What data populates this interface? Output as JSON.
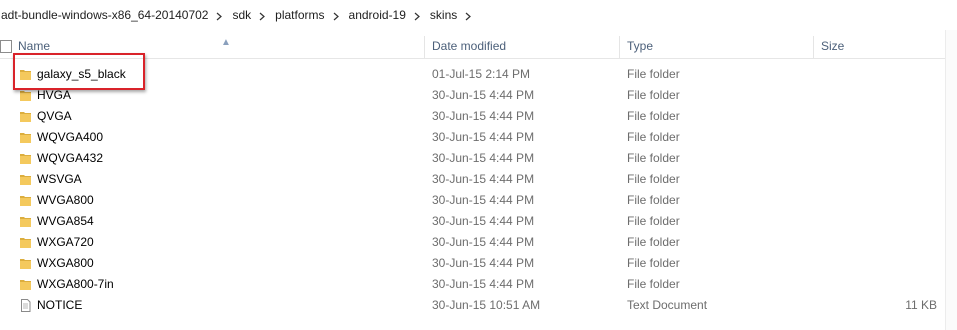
{
  "breadcrumb": [
    {
      "label": "adt-bundle-windows-x86_64-20140702"
    },
    {
      "label": "sdk"
    },
    {
      "label": "platforms"
    },
    {
      "label": "android-19"
    },
    {
      "label": "skins"
    }
  ],
  "columns": {
    "name": "Name",
    "date": "Date modified",
    "type": "Type",
    "size": "Size"
  },
  "files": [
    {
      "name": "galaxy_s5_black",
      "date": "01-Jul-15 2:14 PM",
      "type": "File folder",
      "size": "",
      "icon": "folder-icon"
    },
    {
      "name": "HVGA",
      "date": "30-Jun-15 4:44 PM",
      "type": "File folder",
      "size": "",
      "icon": "folder-icon"
    },
    {
      "name": "QVGA",
      "date": "30-Jun-15 4:44 PM",
      "type": "File folder",
      "size": "",
      "icon": "folder-icon"
    },
    {
      "name": "WQVGA400",
      "date": "30-Jun-15 4:44 PM",
      "type": "File folder",
      "size": "",
      "icon": "folder-icon"
    },
    {
      "name": "WQVGA432",
      "date": "30-Jun-15 4:44 PM",
      "type": "File folder",
      "size": "",
      "icon": "folder-icon"
    },
    {
      "name": "WSVGA",
      "date": "30-Jun-15 4:44 PM",
      "type": "File folder",
      "size": "",
      "icon": "folder-icon"
    },
    {
      "name": "WVGA800",
      "date": "30-Jun-15 4:44 PM",
      "type": "File folder",
      "size": "",
      "icon": "folder-icon"
    },
    {
      "name": "WVGA854",
      "date": "30-Jun-15 4:44 PM",
      "type": "File folder",
      "size": "",
      "icon": "folder-icon"
    },
    {
      "name": "WXGA720",
      "date": "30-Jun-15 4:44 PM",
      "type": "File folder",
      "size": "",
      "icon": "folder-icon"
    },
    {
      "name": "WXGA800",
      "date": "30-Jun-15 4:44 PM",
      "type": "File folder",
      "size": "",
      "icon": "folder-icon"
    },
    {
      "name": "WXGA800-7in",
      "date": "30-Jun-15 4:44 PM",
      "type": "File folder",
      "size": "",
      "icon": "folder-icon"
    },
    {
      "name": "NOTICE",
      "date": "30-Jun-15 10:51 AM",
      "type": "Text Document",
      "size": "11 KB",
      "icon": "text-document-icon"
    }
  ],
  "colors": {
    "highlight": "#d9232a",
    "folder": "#e8b84a",
    "header_text": "#4c607a"
  }
}
